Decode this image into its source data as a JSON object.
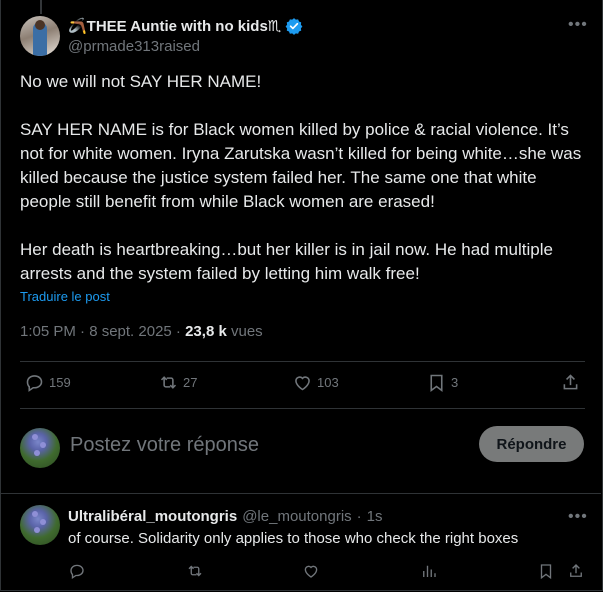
{
  "post": {
    "display_name": "🪃THEE Auntie with no kids♏",
    "handle": "@prmade313raised",
    "paragraphs": [
      "No we will not SAY HER NAME!",
      "SAY HER NAME is for Black women killed by police & racial violence. It’s not for white women. Iryna Zarutska wasn’t killed for being white…she was killed because the justice system failed her. The same one that white people still benefit from while Black women are erased!",
      "Her death is heartbreaking…but her killer is in jail now. He had multiple arrests and the system failed by letting him walk free!"
    ],
    "translate_label": "Traduire le post",
    "time": "1:05 PM · 8 sept. 2025 · ",
    "views_count": "23,8 k",
    "views_label": " vues",
    "verified_icon": "verified-badge-icon",
    "more_icon": "more-icon"
  },
  "actions": {
    "replies": "159",
    "reposts": "27",
    "likes": "103",
    "bookmarks": "3"
  },
  "composer": {
    "placeholder": "Postez votre réponse",
    "button_label": "Répondre"
  },
  "reply": {
    "name": "Ultralibéral_moutongris",
    "handle": "@le_moutongris",
    "sep": "·",
    "age": "1s",
    "text": "of course. Solidarity only applies to those who check the right boxes"
  },
  "colors": {
    "background": "#000000",
    "text": "#e7e9ea",
    "muted": "#71767b",
    "link": "#1d9bf0",
    "verified": "#1d9bf0",
    "divider": "#2f3336"
  }
}
